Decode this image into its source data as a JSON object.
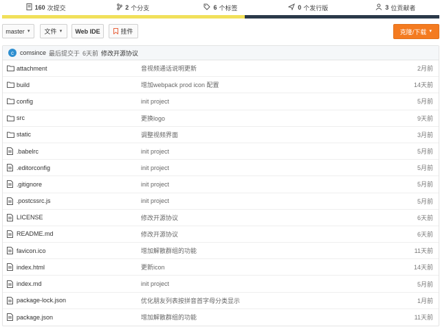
{
  "stats": {
    "commits": {
      "count": "160",
      "label": "次提交"
    },
    "branches": {
      "count": "2",
      "label": "个分支"
    },
    "tags": {
      "count": "6",
      "label": "个标签"
    },
    "releases": {
      "count": "0",
      "label": "个发行版"
    },
    "contributors": {
      "count": "3",
      "label": "位贡献者"
    }
  },
  "language_bar_colors": [
    "#f1e05a",
    "#2b3a4a"
  ],
  "toolbar": {
    "branch": "master",
    "file_menu": "文件",
    "webide": "Web IDE",
    "widget": "挂件",
    "clone": "克隆/下载"
  },
  "commit": {
    "avatar_letter": "c",
    "author": "comsince",
    "prefix": "最后提交于",
    "time": "6天前",
    "message": "修改开源协议"
  },
  "files": [
    {
      "type": "folder",
      "name": "attachment",
      "message": "音视频通话说明更新",
      "time": "2月前"
    },
    {
      "type": "folder",
      "name": "build",
      "message": "增加webpack prod icon 配置",
      "time": "14天前"
    },
    {
      "type": "folder",
      "name": "config",
      "message": "init project",
      "time": "5月前"
    },
    {
      "type": "folder",
      "name": "src",
      "message": "更换logo",
      "time": "9天前"
    },
    {
      "type": "folder",
      "name": "static",
      "message": "调整视频界面",
      "time": "3月前"
    },
    {
      "type": "file",
      "name": ".babelrc",
      "message": "init project",
      "time": "5月前"
    },
    {
      "type": "file",
      "name": ".editorconfig",
      "message": "init project",
      "time": "5月前"
    },
    {
      "type": "file",
      "name": ".gitignore",
      "message": "init project",
      "time": "5月前"
    },
    {
      "type": "file",
      "name": ".postcssrc.js",
      "message": "init project",
      "time": "5月前"
    },
    {
      "type": "file",
      "name": "LICENSE",
      "message": "修改开源协议",
      "time": "6天前"
    },
    {
      "type": "file",
      "name": "README.md",
      "message": "修改开源协议",
      "time": "6天前"
    },
    {
      "type": "file",
      "name": "favicon.ico",
      "message": "增加解散群组的功能",
      "time": "11天前"
    },
    {
      "type": "file",
      "name": "index.html",
      "message": "更新icon",
      "time": "14天前"
    },
    {
      "type": "file",
      "name": "index.md",
      "message": "init project",
      "time": "5月前"
    },
    {
      "type": "file",
      "name": "package-lock.json",
      "message": "优化朋友列表按拼音首字母分类显示",
      "time": "1月前"
    },
    {
      "type": "file",
      "name": "package.json",
      "message": "增加解散群组的功能",
      "time": "11天前"
    }
  ]
}
